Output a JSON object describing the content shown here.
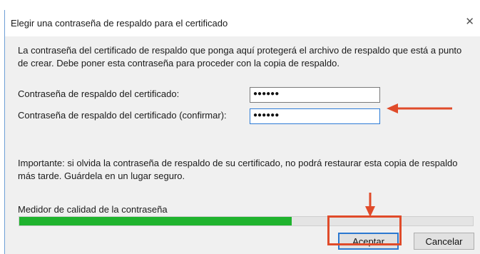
{
  "dialog": {
    "title": "Elegir una contraseña de respaldo para el certificado",
    "close_glyph": "✕",
    "intro": "La contraseña del certificado de respaldo que ponga aquí protegerá el archivo de respaldo que está a punto de crear. Debe poner esta contraseña para proceder con la copia de respaldo."
  },
  "form": {
    "password_label": "Contraseña de respaldo del certificado:",
    "password_value": "●●●●●●",
    "confirm_label": "Contraseña de respaldo del certificado (confirmar):",
    "confirm_value": "●●●●●●"
  },
  "important": "Importante: si olvida la contraseña de respaldo de su certificado, no podrá restaurar esta copia de respaldo más tarde. Guárdela en un lugar seguro.",
  "meter": {
    "label": "Medidor de calidad de la contraseña",
    "fill_percent": 60,
    "fill_color": "#1fb32e"
  },
  "buttons": {
    "ok": "Aceptar",
    "cancel": "Cancelar"
  },
  "annotations": {
    "accent_color": "#e04b2a",
    "arrow_icon_left": "arrow-left-icon",
    "arrow_icon_down": "arrow-down-icon"
  }
}
